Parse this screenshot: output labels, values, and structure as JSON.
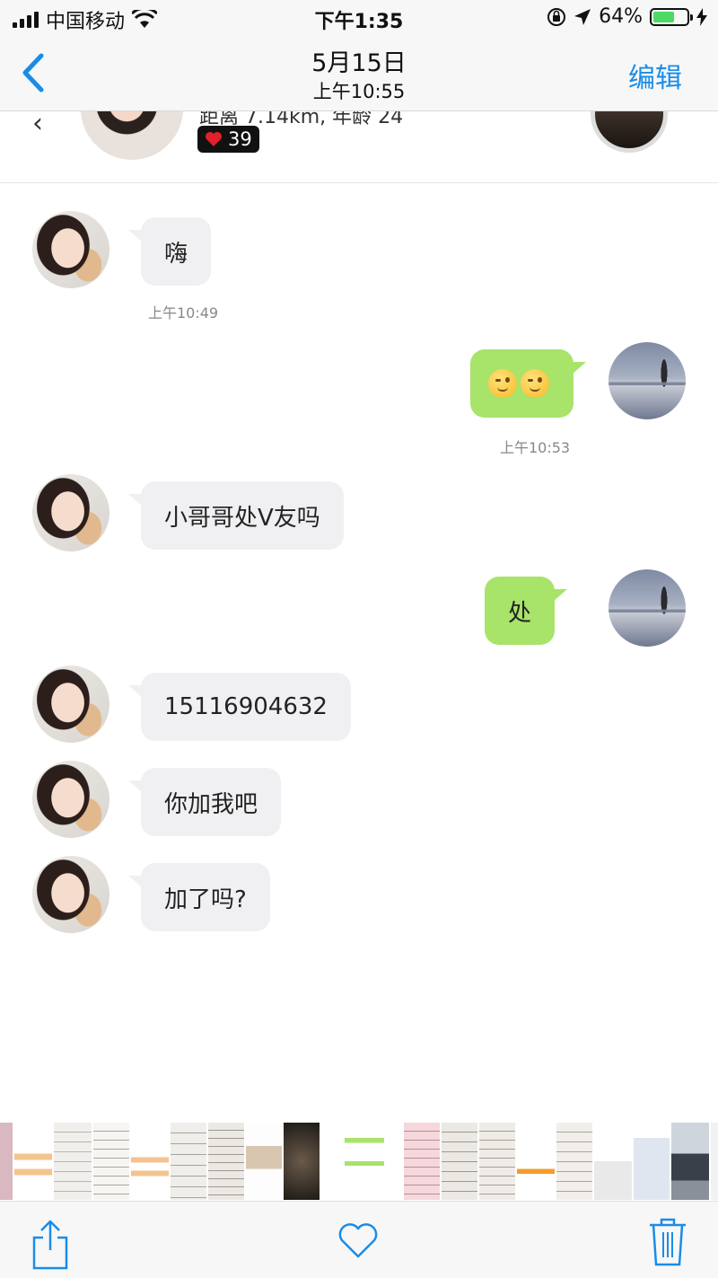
{
  "status_bar": {
    "carrier": "中国移动",
    "time": "下午1:35",
    "battery_percent": "64%",
    "battery_level": 0.64,
    "icons": [
      "signal-icon",
      "wifi-icon",
      "rotation-lock-icon",
      "location-icon",
      "battery-icon",
      "charging-icon"
    ]
  },
  "nav": {
    "back_icon": "chevron-left-icon",
    "title": "5月15日",
    "subtitle": "上午10:55",
    "edit_label": "编辑"
  },
  "profile_header": {
    "info_text": "距离 7.14km, 年龄 24",
    "likes_count": "39",
    "like_icon": "heart-icon"
  },
  "messages": [
    {
      "side": "in",
      "text": "嗨",
      "time": "上午10:49"
    },
    {
      "side": "out",
      "emoji": "winking-face x2",
      "time": "上午10:53"
    },
    {
      "side": "in",
      "text": "小哥哥处V友吗"
    },
    {
      "side": "out",
      "text": "处"
    },
    {
      "side": "in",
      "text": "15116904632"
    },
    {
      "side": "in",
      "text": "你加我吧"
    },
    {
      "side": "in",
      "text": "加了吗?"
    }
  ],
  "toolbar": {
    "share_icon": "share-icon",
    "favorite_icon": "heart-outline-icon",
    "delete_icon": "trash-icon"
  },
  "colors": {
    "accent": "#1a8ce8",
    "incoming_bubble": "#f0f0f2",
    "outgoing_bubble": "#a8e36a",
    "battery_fill": "#4cd964"
  }
}
